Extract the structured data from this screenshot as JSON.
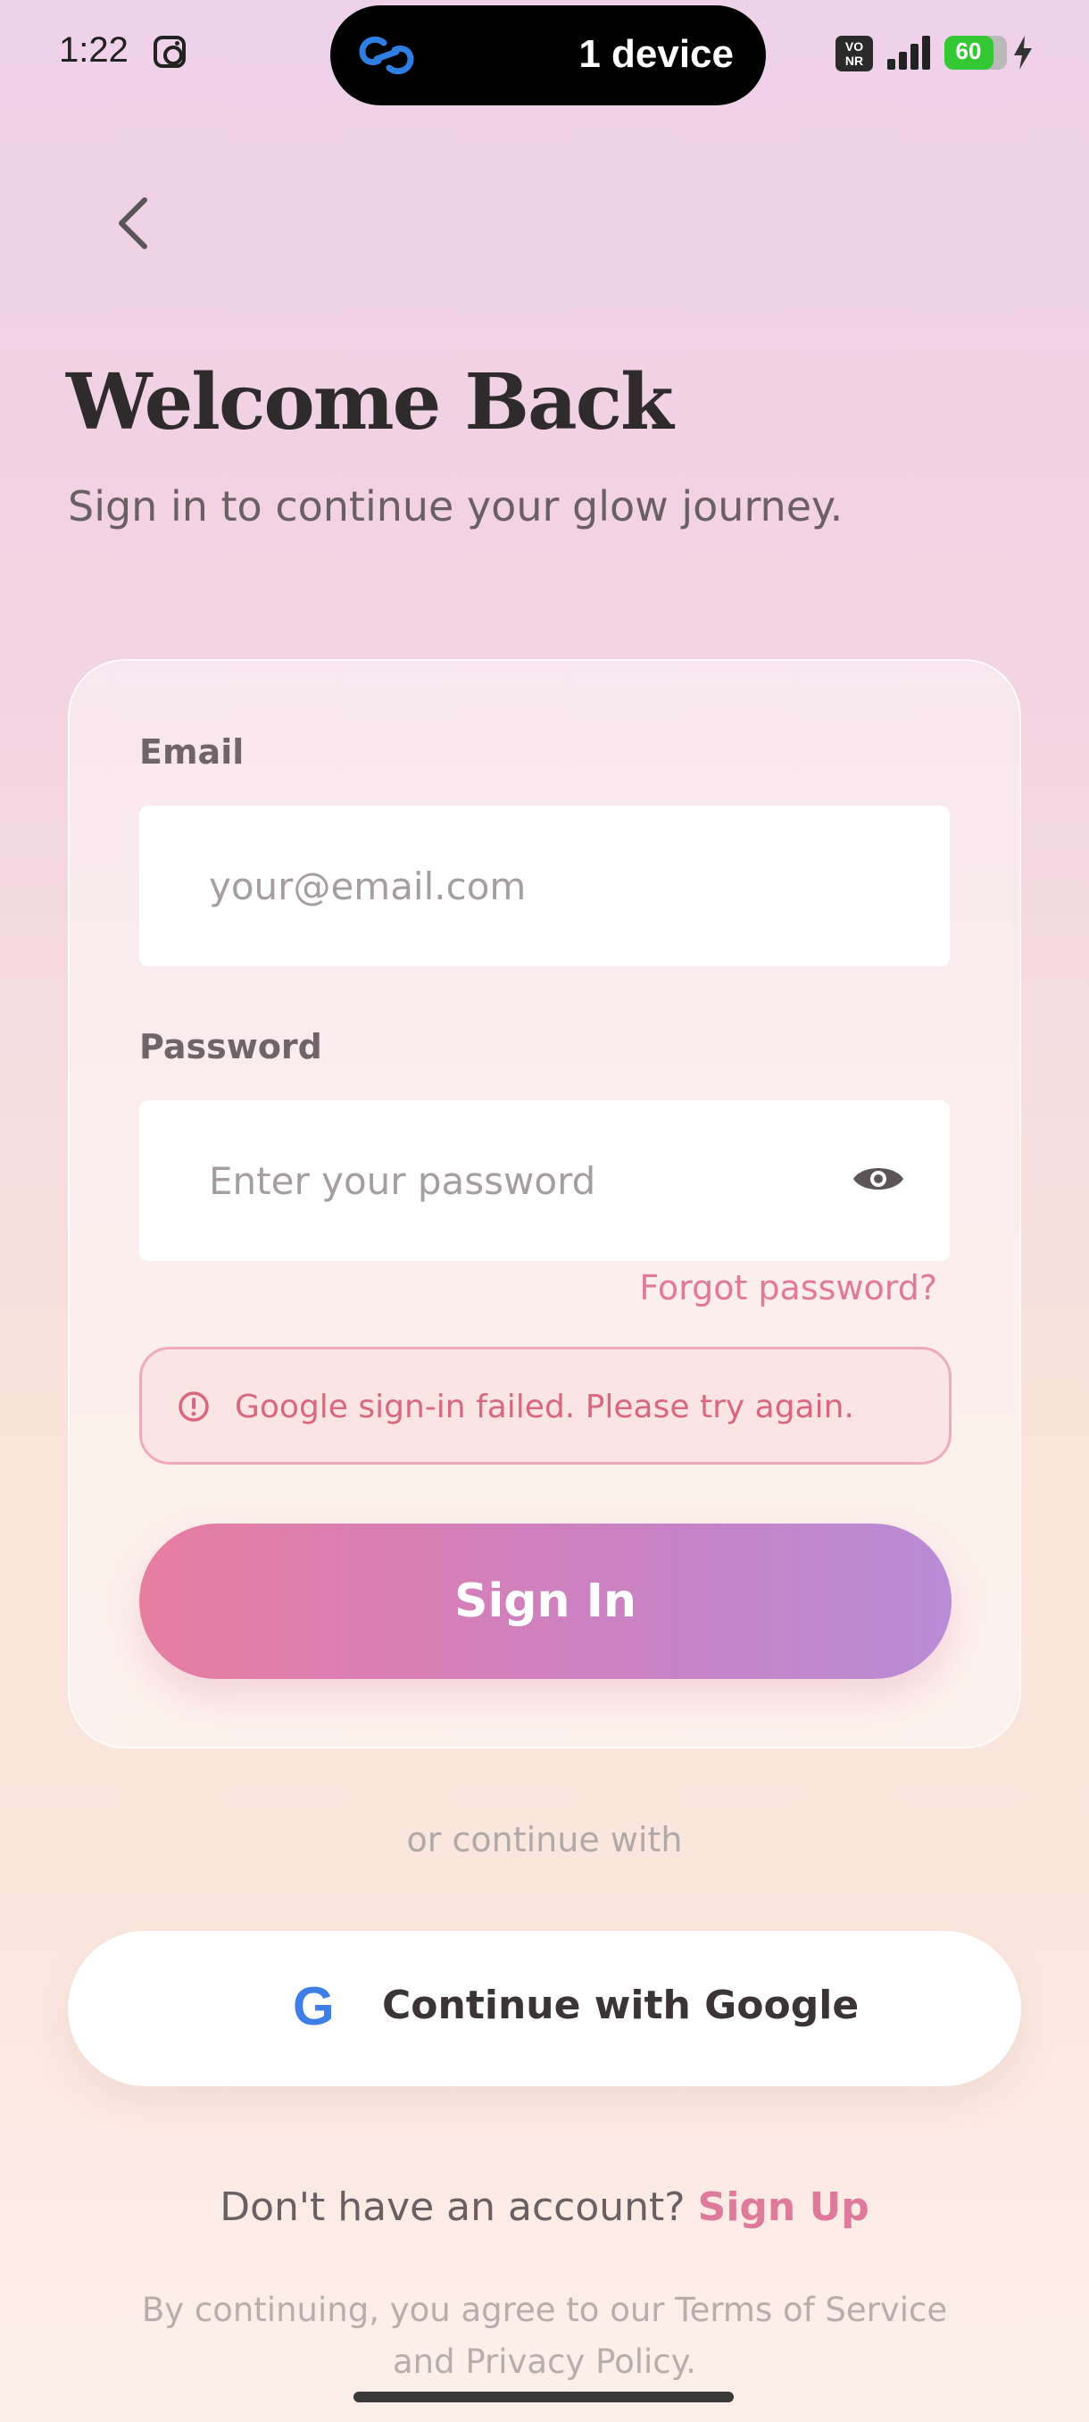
{
  "status_bar": {
    "time": "1:22",
    "island_text": "1 device",
    "vonr_top": "VO",
    "vonr_bottom": "NR",
    "battery_level": "60",
    "battery_fraction": 0.78
  },
  "header": {
    "title": "Welcome Back",
    "subtitle": "Sign in to continue your glow journey."
  },
  "form": {
    "email_label": "Email",
    "email_placeholder": "your@email.com",
    "password_label": "Password",
    "password_placeholder": "Enter your password",
    "forgot_password": "Forgot password?",
    "error_message": "Google sign-in failed. Please try again.",
    "signin_label": "Sign In"
  },
  "alt_auth": {
    "divider": "or continue with",
    "google_icon_letter": "G",
    "google_label": "Continue with Google"
  },
  "footer": {
    "no_account": "Don't have an account?",
    "signup_link": "Sign Up",
    "legal_line1": "By continuing, you agree to our Terms of Service",
    "legal_line2": "and Privacy Policy."
  },
  "colors": {
    "accent_pink": "#e07a9c",
    "gradient_start": "#e77da1",
    "gradient_end": "#b98cd6",
    "google_blue": "#3d7fe6",
    "error_red": "#d9677e"
  }
}
